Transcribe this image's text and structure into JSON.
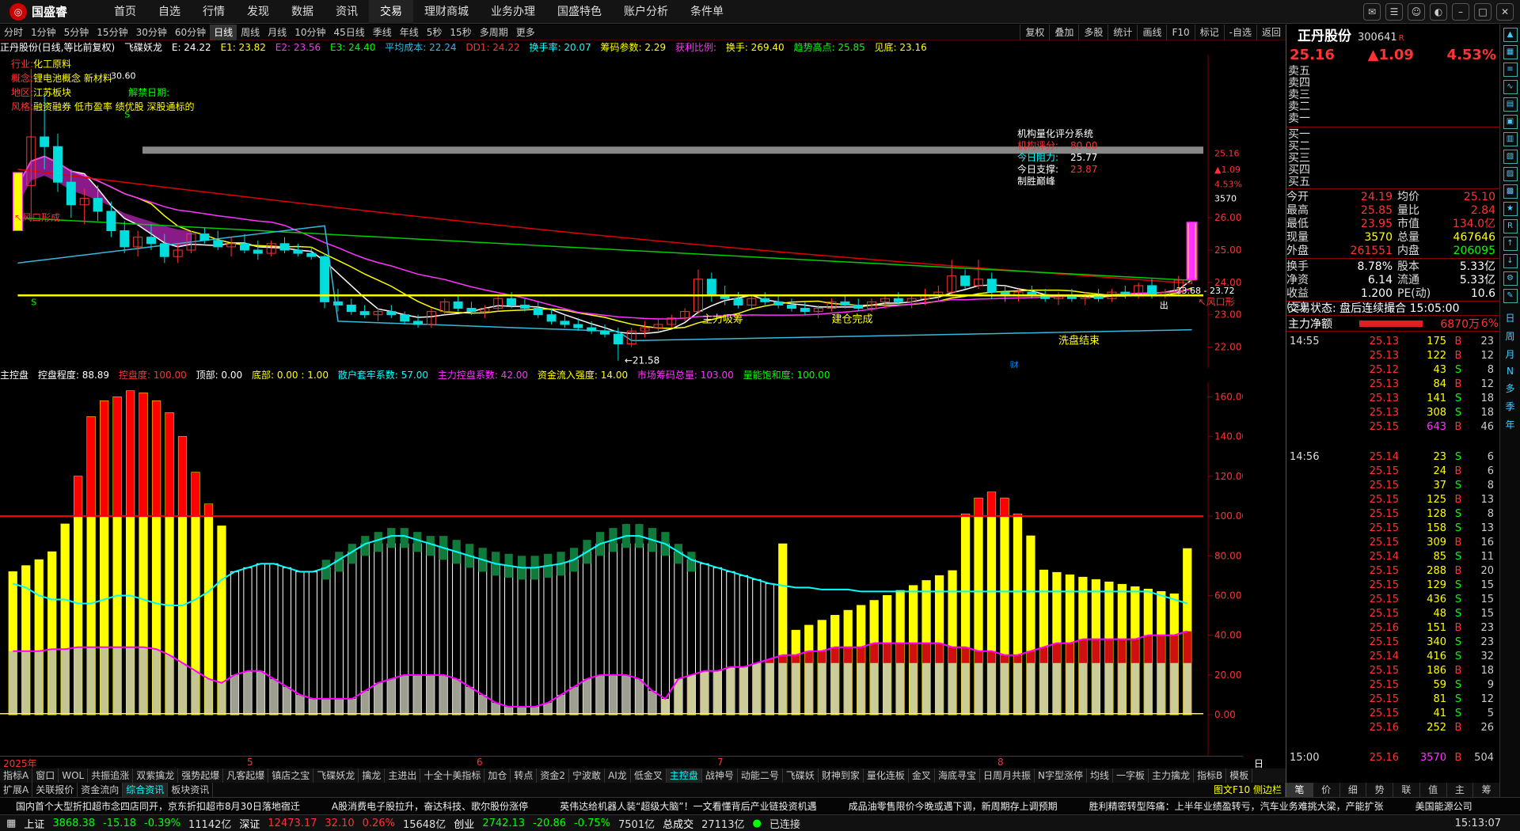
{
  "app": {
    "logo": "国盛睿",
    "menu": [
      "首页",
      "自选",
      "行情",
      "发现",
      "数据",
      "资讯",
      "交易",
      "理财商城",
      "业务办理",
      "国盛特色",
      "账户分析",
      "条件单"
    ],
    "active_menu": "交易"
  },
  "period_bar": {
    "items": [
      "分时",
      "1分钟",
      "5分钟",
      "15分钟",
      "30分钟",
      "60分钟",
      "日线",
      "周线",
      "月线",
      "10分钟",
      "45日线",
      "季线",
      "年线",
      "5秒",
      "15秒",
      "多周期",
      "更多"
    ],
    "active": "日线",
    "tools": [
      "复权",
      "叠加",
      "多股",
      "统计",
      "画线",
      "F10",
      "标记",
      "-自选",
      "返回"
    ]
  },
  "kline_header": {
    "stock": "正丹股份(日线,等比前复权)",
    "indicator": "飞碟妖龙",
    "E": "E: 24.22",
    "E1": "E1: 23.82",
    "E2": "E2: 23.56",
    "E3": "E3: 24.40",
    "avg_cost": "平均成本: 22.24",
    "DD1": "DD1: 24.22",
    "turnover": "换手率: 20.07",
    "chip": "筹码参数: 2.29",
    "profit": "获利比例:",
    "hand": "换手: 269.40",
    "trend_high": "趋势高点: 25.85",
    "top": "见底: 23.16"
  },
  "info": {
    "industry_label": "行业:",
    "industry": "化工原料",
    "concept_label": "概念:",
    "concept": "锂电池概念 新材料",
    "region_label": "地区:",
    "region": "江苏板块",
    "style_label": "风格:",
    "style": "融资融券 低市盈率 绩优股 深股通标的",
    "unlock": "解禁日期:"
  },
  "score_box": {
    "title": "机构量化评分系统",
    "score_label": "机构评分:",
    "score": "80.00",
    "resist_label": "今日阻力:",
    "resist": "25.77",
    "support_label": "今日支撑:",
    "support": "23.87",
    "slogan": "制胜巅峰"
  },
  "annotations": {
    "wind1": "↖风口形成",
    "low": "←21.58",
    "main_absorb": "主力吸筹",
    "build_done": "建仓完成",
    "wash_done": "洗盘结束",
    "out": "出",
    "cai": "财",
    "wind2": "↖风口形",
    "range": "23.68 - 23.72",
    "s1": "S",
    "s2": "S",
    "top_high": "30.60"
  },
  "price_axis": {
    "labels": [
      "26.00",
      "25.00",
      "24.00",
      "23.00",
      "22.00"
    ],
    "current": "25.16",
    "chg": "▲1.09",
    "pct": "4.53%",
    "vol": "3570"
  },
  "ctrl_header": {
    "name": "主控盘",
    "degree": "控盘程度: 88.89",
    "top": "控盘度: 100.00",
    "top2": "顶部: 0.00",
    "bottom": "底部: 0.00 : 1.00",
    "retail": "散户套牢系数: 57.00",
    "main": "主力控盘系数: 42.00",
    "inflow": "资金流入强度: 14.00",
    "market": "市场筹码总量: 103.00",
    "vol": "量能饱和度: 100.00"
  },
  "ctrl_axis": {
    "labels": [
      "160.00",
      "140.00",
      "120.00",
      "100.00",
      "80.00",
      "60.00",
      "40.00",
      "20.00",
      "0.00"
    ]
  },
  "time_axis": {
    "labels": [
      "2025年",
      "5",
      "6",
      "7",
      "8"
    ],
    "right": "日线"
  },
  "tabs1": [
    "指标A",
    "窗口",
    "WOL",
    "共振追涨",
    "双紫擒龙",
    "强势起爆",
    "凡客起爆",
    "镇店之宝",
    "飞碟妖龙",
    "擒龙",
    "主进出",
    "十全十美指标",
    "加仓",
    "转点",
    "资金2",
    "宁波敢",
    "AI龙",
    "低金叉",
    "主控盘",
    "战神号",
    "动能二号",
    "飞碟妖",
    "财神到家",
    "量化连板",
    "金叉",
    "海底寻宝",
    "日周月共振",
    "N字型涨停",
    "均线",
    "一字板",
    "主力擒龙",
    "指标B",
    "模板"
  ],
  "tabs1_active": "主控盘",
  "tabs2": [
    "扩展A",
    "关联报价",
    "资金流向",
    "综合资讯",
    "板块资讯"
  ],
  "tabs2_active": "综合资讯",
  "tabs2_right": "图文F10 侧边栏",
  "news": [
    "国内首个大型折扣超市念四店同开，京东折扣超市8月30日落地宿迁",
    "A股消费电子股拉升，奋达科技、歌尔股份涨停",
    "英伟达给机器人装“超级大脑”！一文看懂背后产业链投资机遇",
    "成品油零售限价今晚或遇下调，新周期存上调预期",
    "胜利精密转型阵痛：上半年业绩盈转亏，汽车业务难挑大梁，产能扩张",
    "美国能源公司"
  ],
  "status": {
    "sh_label": "上证",
    "sh": "3868.38",
    "sh_chg": "-15.18",
    "sh_pct": "-0.39%",
    "sh_amt": "11142亿",
    "sz_label": "深证",
    "sz": "12473.17",
    "sz_chg": "32.10",
    "sz_pct": "0.26%",
    "sz_amt": "15648亿",
    "cy_label": "创业",
    "cy": "2742.13",
    "cy_chg": "-20.86",
    "cy_pct": "-0.75%",
    "cy_amt": "7501亿",
    "total_label": "总成交",
    "total": "27113亿",
    "conn": "已连接",
    "time": "15:13:07"
  },
  "right": {
    "name": "正丹股份",
    "code": "300641",
    "tag": "R",
    "price": "25.16",
    "chg": "▲1.09",
    "pct": "4.53%",
    "sell": [
      "卖五",
      "卖四",
      "卖三",
      "卖二",
      "卖一"
    ],
    "buy": [
      "买一",
      "买二",
      "买三",
      "买四",
      "买五"
    ],
    "quote": [
      [
        "今开",
        "24.19",
        "均价",
        "25.10"
      ],
      [
        "最高",
        "25.85",
        "量比",
        "2.84"
      ],
      [
        "最低",
        "23.95",
        "市值",
        "134.0亿"
      ],
      [
        "现量",
        "3570",
        "总量",
        "467646"
      ],
      [
        "外盘",
        "261551",
        "内盘",
        "206095"
      ]
    ],
    "quote2": [
      [
        "换手",
        "8.78%",
        "股本",
        "5.33亿"
      ],
      [
        "净资",
        "6.14",
        "流通",
        "5.33亿"
      ],
      [
        "收益(三)",
        "1.200",
        "PE(动)",
        "10.6"
      ]
    ],
    "trade_state": "交易状态: 盘后连续撮合 15:05:00",
    "net_label": "主力净额",
    "net": "6870万",
    "net_pct": "6%",
    "ticks": [
      [
        "14:55",
        "25.13",
        "175",
        "B",
        "23"
      ],
      [
        "",
        "25.13",
        "122",
        "B",
        "12"
      ],
      [
        "",
        "25.12",
        "43",
        "S",
        "8"
      ],
      [
        "",
        "25.13",
        "84",
        "B",
        "12"
      ],
      [
        "",
        "25.13",
        "141",
        "S",
        "18"
      ],
      [
        "",
        "25.13",
        "308",
        "S",
        "18"
      ],
      [
        "",
        "25.15",
        "643",
        "B",
        "46"
      ],
      [
        "14:56",
        "25.14",
        "23",
        "S",
        "6"
      ],
      [
        "",
        "25.15",
        "24",
        "B",
        "6"
      ],
      [
        "",
        "25.15",
        "37",
        "S",
        "8"
      ],
      [
        "",
        "25.15",
        "125",
        "B",
        "13"
      ],
      [
        "",
        "25.15",
        "128",
        "S",
        "8"
      ],
      [
        "",
        "25.15",
        "158",
        "S",
        "13"
      ],
      [
        "",
        "25.15",
        "309",
        "B",
        "16"
      ],
      [
        "",
        "25.14",
        "85",
        "S",
        "11"
      ],
      [
        "",
        "25.15",
        "288",
        "B",
        "20"
      ],
      [
        "",
        "25.15",
        "129",
        "S",
        "15"
      ],
      [
        "",
        "25.15",
        "436",
        "S",
        "15"
      ],
      [
        "",
        "25.15",
        "48",
        "S",
        "15"
      ],
      [
        "",
        "25.16",
        "151",
        "B",
        "23"
      ],
      [
        "",
        "25.15",
        "340",
        "S",
        "23"
      ],
      [
        "",
        "25.14",
        "416",
        "S",
        "32"
      ],
      [
        "",
        "25.15",
        "186",
        "B",
        "18"
      ],
      [
        "",
        "25.15",
        "59",
        "S",
        "9"
      ],
      [
        "",
        "25.15",
        "81",
        "S",
        "12"
      ],
      [
        "",
        "25.15",
        "41",
        "S",
        "5"
      ],
      [
        "",
        "25.16",
        "252",
        "B",
        "26"
      ],
      [
        "15:00",
        "25.16",
        "3570",
        "B",
        "504"
      ]
    ],
    "tabs": [
      "笔",
      "价",
      "细",
      "势",
      "联",
      "值",
      "主",
      "筹"
    ]
  },
  "sidebar": [
    "日",
    "周",
    "月",
    "N",
    "多",
    "季",
    "年"
  ],
  "colors": {
    "up": "#ff3333",
    "down": "#00dddd",
    "ma5": "#ffffff",
    "ma10": "#ffff00",
    "ma20": "#ff33ff",
    "ma60": "#00cc00",
    "ma120": "#dd0000",
    "avg": "#33bbdd"
  },
  "chart_data": [
    {
      "type": "candlestick",
      "note": "daily candles",
      "series": [
        [
          26.0,
          27.4,
          25.6,
          27.0
        ],
        [
          27.0,
          30.6,
          25.9,
          28.5
        ],
        [
          28.5,
          29.8,
          27.5,
          28.2
        ],
        [
          28.2,
          28.6,
          26.8,
          27.1
        ],
        [
          27.1,
          27.5,
          26.0,
          26.4
        ],
        [
          26.4,
          26.9,
          25.8,
          26.6
        ],
        [
          26.6,
          27.0,
          25.9,
          26.2
        ],
        [
          26.2,
          26.5,
          25.4,
          25.6
        ],
        [
          25.6,
          25.9,
          24.9,
          25.1
        ],
        [
          25.1,
          25.6,
          24.8,
          25.4
        ],
        [
          25.4,
          25.8,
          25.0,
          25.2
        ],
        [
          25.2,
          25.5,
          24.6,
          24.8
        ],
        [
          24.8,
          25.2,
          24.6,
          25.0
        ],
        [
          25.0,
          25.6,
          24.9,
          25.5
        ],
        [
          25.5,
          25.7,
          25.2,
          25.3
        ],
        [
          25.3,
          25.6,
          25.0,
          25.1
        ],
        [
          25.1,
          25.4,
          24.8,
          25.2
        ],
        [
          25.2,
          25.5,
          24.9,
          25.0
        ],
        [
          25.0,
          25.3,
          24.7,
          24.9
        ],
        [
          24.9,
          25.3,
          24.8,
          25.2
        ],
        [
          25.2,
          25.4,
          24.9,
          25.0
        ],
        [
          25.0,
          25.2,
          24.8,
          24.9
        ],
        [
          24.9,
          25.1,
          24.7,
          24.8
        ],
        [
          24.8,
          24.9,
          23.2,
          23.4
        ],
        [
          23.4,
          23.8,
          23.1,
          23.3
        ],
        [
          23.3,
          23.5,
          23.0,
          23.1
        ],
        [
          23.1,
          23.3,
          22.9,
          23.0
        ],
        [
          23.0,
          23.2,
          22.8,
          23.1
        ],
        [
          23.1,
          23.3,
          22.9,
          23.0
        ],
        [
          23.0,
          23.1,
          22.7,
          22.8
        ],
        [
          22.8,
          23.0,
          22.6,
          22.7
        ],
        [
          22.7,
          23.2,
          22.6,
          23.1
        ],
        [
          23.1,
          23.5,
          23.0,
          23.4
        ],
        [
          23.4,
          23.6,
          23.1,
          23.2
        ],
        [
          23.2,
          23.4,
          23.0,
          23.1
        ],
        [
          23.1,
          23.3,
          22.9,
          23.2
        ],
        [
          23.2,
          23.6,
          23.1,
          23.5
        ],
        [
          23.5,
          23.7,
          23.2,
          23.3
        ],
        [
          23.3,
          23.5,
          23.1,
          23.2
        ],
        [
          23.2,
          23.4,
          22.9,
          23.0
        ],
        [
          23.0,
          23.2,
          22.7,
          22.8
        ],
        [
          22.8,
          23.0,
          22.6,
          22.7
        ],
        [
          22.7,
          22.9,
          22.5,
          22.6
        ],
        [
          22.6,
          22.8,
          22.4,
          22.5
        ],
        [
          22.5,
          22.7,
          22.3,
          22.4
        ],
        [
          22.4,
          22.6,
          21.58,
          22.1
        ],
        [
          22.1,
          22.6,
          22.0,
          22.5
        ],
        [
          22.5,
          22.8,
          22.3,
          22.6
        ],
        [
          22.6,
          22.9,
          22.5,
          22.7
        ],
        [
          22.7,
          23.0,
          22.6,
          22.9
        ],
        [
          22.9,
          23.2,
          22.8,
          23.1
        ],
        [
          23.1,
          24.4,
          23.0,
          24.1
        ],
        [
          24.1,
          24.3,
          23.4,
          23.6
        ],
        [
          23.6,
          23.9,
          23.3,
          23.5
        ],
        [
          23.5,
          23.7,
          23.2,
          23.3
        ],
        [
          23.3,
          23.6,
          23.2,
          23.5
        ],
        [
          23.5,
          23.7,
          23.3,
          23.4
        ],
        [
          23.4,
          23.6,
          23.2,
          23.3
        ],
        [
          23.3,
          23.5,
          23.1,
          23.2
        ],
        [
          23.2,
          23.4,
          23.0,
          23.1
        ],
        [
          23.1,
          23.3,
          22.9,
          23.2
        ],
        [
          23.2,
          23.5,
          23.1,
          23.4
        ],
        [
          23.4,
          23.6,
          23.2,
          23.3
        ],
        [
          23.3,
          23.5,
          23.1,
          23.2
        ],
        [
          23.2,
          23.5,
          23.1,
          23.4
        ],
        [
          23.4,
          23.6,
          23.2,
          23.5
        ],
        [
          23.5,
          23.7,
          23.3,
          23.4
        ],
        [
          23.4,
          23.6,
          23.2,
          23.5
        ],
        [
          23.5,
          23.8,
          23.3,
          23.6
        ],
        [
          23.6,
          23.9,
          23.4,
          23.7
        ],
        [
          23.7,
          24.7,
          23.6,
          24.2
        ],
        [
          24.2,
          24.4,
          23.8,
          23.9
        ],
        [
          23.9,
          24.7,
          23.8,
          24.1
        ],
        [
          24.1,
          24.3,
          23.5,
          23.7
        ],
        [
          23.7,
          23.9,
          23.4,
          23.6
        ],
        [
          23.6,
          23.8,
          23.4,
          23.7
        ],
        [
          23.7,
          23.9,
          23.5,
          23.6
        ],
        [
          23.6,
          23.8,
          23.4,
          23.5
        ],
        [
          23.5,
          23.7,
          23.3,
          23.6
        ],
        [
          23.6,
          23.8,
          23.4,
          23.5
        ],
        [
          23.5,
          23.7,
          23.3,
          23.6
        ],
        [
          23.6,
          23.8,
          23.4,
          23.5
        ],
        [
          23.5,
          23.8,
          23.4,
          23.7
        ],
        [
          23.7,
          23.9,
          23.5,
          23.6
        ],
        [
          23.6,
          24.0,
          23.5,
          23.9
        ],
        [
          23.9,
          24.1,
          23.5,
          23.6
        ],
        [
          23.6,
          23.8,
          23.5,
          23.7
        ],
        [
          23.7,
          24.2,
          23.6,
          24.07
        ],
        [
          24.07,
          25.85,
          23.95,
          25.16
        ]
      ],
      "ylim": [
        21.5,
        30.8
      ]
    },
    {
      "type": "bar",
      "name": "主控盘",
      "ylim": [
        0,
        165
      ],
      "values": [
        72,
        75,
        78,
        82,
        96,
        120,
        150,
        158,
        160,
        163,
        162,
        158,
        152,
        140,
        122,
        106,
        95,
        88,
        86,
        86,
        86,
        86,
        86,
        86,
        86,
        86,
        86,
        86,
        86,
        86,
        86,
        86,
        86,
        86,
        86,
        86,
        86,
        86,
        86,
        86,
        86,
        86,
        86,
        86,
        86,
        86,
        86,
        86,
        86,
        86,
        86,
        86,
        86,
        86,
        86,
        86,
        86,
        86,
        86,
        86,
        86,
        86,
        86,
        86,
        86,
        86,
        86,
        86,
        86,
        86,
        86,
        86,
        86,
        86,
        86,
        86,
        86,
        86,
        86,
        86,
        86,
        86,
        86,
        86,
        86,
        86,
        86,
        86,
        86,
        86,
        86
      ],
      "cyan": [
        66,
        64,
        60,
        58,
        58,
        56,
        56,
        58,
        60,
        60,
        58,
        56,
        55,
        55,
        58,
        62,
        68,
        72,
        74,
        76,
        76,
        74,
        72,
        72,
        74,
        78,
        82,
        86,
        88,
        90,
        90,
        88,
        86,
        84,
        82,
        80,
        78,
        76,
        75,
        74,
        74,
        75,
        76,
        78,
        82,
        86,
        88,
        90,
        90,
        88,
        86,
        82,
        78,
        76,
        74,
        72,
        70,
        68,
        66,
        65,
        64,
        64,
        63,
        63,
        63,
        62,
        62,
        62,
        62,
        62,
        62,
        62,
        62,
        62,
        62,
        62,
        62,
        62,
        62,
        62,
        62,
        62,
        62,
        62,
        62,
        62,
        62,
        62,
        60,
        58,
        56
      ],
      "magenta": [
        32,
        32,
        32,
        33,
        33,
        34,
        34,
        34,
        34,
        34,
        34,
        33,
        30,
        26,
        22,
        18,
        16,
        20,
        22,
        22,
        18,
        14,
        10,
        8,
        8,
        8,
        8,
        12,
        16,
        18,
        20,
        20,
        20,
        20,
        18,
        14,
        10,
        6,
        4,
        4,
        4,
        6,
        10,
        14,
        18,
        20,
        20,
        20,
        18,
        12,
        8,
        18,
        20,
        22,
        22,
        24,
        24,
        26,
        28,
        30,
        30,
        32,
        32,
        34,
        34,
        34,
        36,
        36,
        36,
        36,
        36,
        36,
        34,
        34,
        32,
        32,
        30,
        30,
        32,
        34,
        36,
        36,
        38,
        38,
        38,
        38,
        38,
        40,
        40,
        40,
        42
      ]
    }
  ]
}
